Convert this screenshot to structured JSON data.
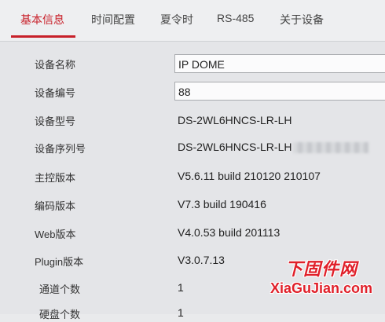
{
  "tabs": [
    {
      "label": "基本信息",
      "active": true
    },
    {
      "label": "时间配置",
      "active": false
    },
    {
      "label": "夏令时",
      "active": false
    },
    {
      "label": "RS-485",
      "active": false
    },
    {
      "label": "关于设备",
      "active": false
    }
  ],
  "rows": [
    {
      "label": "设备名称",
      "value": "IP DOME",
      "editable": true
    },
    {
      "label": "设备编号",
      "value": "88",
      "editable": true
    },
    {
      "label": "设备型号",
      "value": "DS-2WL6HNCS-LR-LH",
      "editable": false
    },
    {
      "label": "设备序列号",
      "value": "DS-2WL6HNCS-LR-LH",
      "editable": false
    },
    {
      "label": "主控版本",
      "value": "V5.6.11 build 210120 210107",
      "editable": false
    },
    {
      "label": "编码版本",
      "value": "V7.3 build 190416",
      "editable": false
    },
    {
      "label": "Web版本",
      "value": "V4.0.53 build 201113",
      "editable": false
    },
    {
      "label": "Plugin版本",
      "value": "V3.0.7.13",
      "editable": false
    },
    {
      "label": "通道个数",
      "value": "1",
      "editable": false
    },
    {
      "label": "硬盘个数",
      "value": "1",
      "editable": false
    }
  ],
  "watermark": {
    "title": "下固件网",
    "url": "XiaGuJian.com"
  },
  "colors": {
    "accent": "#c8202a",
    "watermark": "#e0202a"
  }
}
